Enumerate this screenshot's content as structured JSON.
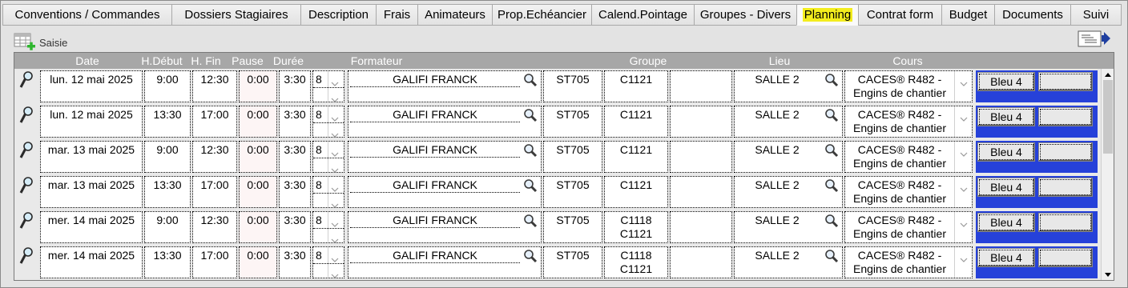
{
  "tabs": [
    {
      "label": "Conventions / Commandes",
      "active": false
    },
    {
      "label": "Dossiers Stagiaires",
      "active": false
    },
    {
      "label": "Description",
      "active": false
    },
    {
      "label": "Frais",
      "active": false
    },
    {
      "label": "Animateurs",
      "active": false
    },
    {
      "label": "Prop.Echéancier",
      "active": false
    },
    {
      "label": "Calend.Pointage",
      "active": false
    },
    {
      "label": "Groupes - Divers",
      "active": false
    },
    {
      "label": "Planning",
      "active": true
    },
    {
      "label": "Contrat form",
      "active": false
    },
    {
      "label": "Budget",
      "active": false
    },
    {
      "label": "Documents",
      "active": false
    },
    {
      "label": "Suivi",
      "active": false
    }
  ],
  "toolbar": {
    "saisie_label": "Saisie",
    "saisie_icon": "grid-add-icon",
    "export_icon": "export-document-icon"
  },
  "grid": {
    "headers": {
      "date": "Date",
      "h_debut": "H.Début",
      "h_fin": "H. Fin",
      "pause": "Pause",
      "duree": "Durée",
      "formateur": "Formateur",
      "groupe": "Groupe",
      "lieu": "Lieu",
      "cours": "Cours"
    },
    "rows": [
      {
        "date": "lun. 12 mai 2025",
        "debut": "9:00",
        "fin": "12:30",
        "pause": "0:00",
        "duree": "3:30",
        "code": "8",
        "formateur": "GALIFI FRANCK",
        "salle_code": "ST705",
        "groupe1": "C1121",
        "groupe2": "",
        "lieu": "SALLE 2",
        "cours1": "CACES® R482 -",
        "cours2": "Engins de chantier",
        "bleu": "Bleu 4"
      },
      {
        "date": "lun. 12 mai 2025",
        "debut": "13:30",
        "fin": "17:00",
        "pause": "0:00",
        "duree": "3:30",
        "code": "8",
        "formateur": "GALIFI FRANCK",
        "salle_code": "ST705",
        "groupe1": "C1121",
        "groupe2": "",
        "lieu": "SALLE 2",
        "cours1": "CACES® R482 -",
        "cours2": "Engins de chantier",
        "bleu": "Bleu 4"
      },
      {
        "date": "mar. 13 mai 2025",
        "debut": "9:00",
        "fin": "12:30",
        "pause": "0:00",
        "duree": "3:30",
        "code": "8",
        "formateur": "GALIFI FRANCK",
        "salle_code": "ST705",
        "groupe1": "C1121",
        "groupe2": "",
        "lieu": "SALLE 2",
        "cours1": "CACES® R482 -",
        "cours2": "Engins de chantier",
        "bleu": "Bleu 4"
      },
      {
        "date": "mar. 13 mai 2025",
        "debut": "13:30",
        "fin": "17:00",
        "pause": "0:00",
        "duree": "3:30",
        "code": "8",
        "formateur": "GALIFI FRANCK",
        "salle_code": "ST705",
        "groupe1": "C1121",
        "groupe2": "",
        "lieu": "SALLE 2",
        "cours1": "CACES® R482 -",
        "cours2": "Engins de chantier",
        "bleu": "Bleu 4"
      },
      {
        "date": "mer. 14 mai 2025",
        "debut": "9:00",
        "fin": "12:30",
        "pause": "0:00",
        "duree": "3:30",
        "code": "8",
        "formateur": "GALIFI FRANCK",
        "salle_code": "ST705",
        "groupe1": "C1118",
        "groupe2": "C1121",
        "lieu": "SALLE 2",
        "cours1": "CACES® R482 -",
        "cours2": "Engins de chantier",
        "bleu": "Bleu 4"
      },
      {
        "date": "mer. 14 mai 2025",
        "debut": "13:30",
        "fin": "17:00",
        "pause": "0:00",
        "duree": "3:30",
        "code": "8",
        "formateur": "GALIFI FRANCK",
        "salle_code": "ST705",
        "groupe1": "C1118",
        "groupe2": "C1121",
        "lieu": "SALLE 2",
        "cours1": "CACES® R482 -",
        "cours2": "Engins de chantier",
        "bleu": "Bleu 4"
      }
    ]
  },
  "colors": {
    "header_bg": "#a7a7a7",
    "active_tab_highlight": "#f3ed1e",
    "bleu_color": "#2641d9"
  }
}
